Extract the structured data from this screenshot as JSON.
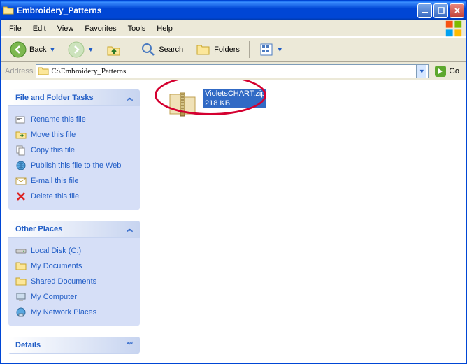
{
  "titlebar": {
    "title": "Embroidery_Patterns"
  },
  "menubar": {
    "items": [
      "File",
      "Edit",
      "View",
      "Favorites",
      "Tools",
      "Help"
    ]
  },
  "toolbar": {
    "back_label": "Back",
    "search_label": "Search",
    "folders_label": "Folders"
  },
  "addressbar": {
    "label": "Address",
    "path": "C:\\Embroidery_Patterns",
    "go_label": "Go"
  },
  "panels": {
    "tasks": {
      "title": "File and Folder Tasks",
      "items": [
        "Rename this file",
        "Move this file",
        "Copy this file",
        "Publish this file to the Web",
        "E-mail this file",
        "Delete this file"
      ]
    },
    "places": {
      "title": "Other Places",
      "items": [
        "Local Disk (C:)",
        "My Documents",
        "Shared Documents",
        "My Computer",
        "My Network Places"
      ]
    },
    "details": {
      "title": "Details"
    }
  },
  "file": {
    "name": "VioletsCHART.zip",
    "size": "218 KB"
  }
}
